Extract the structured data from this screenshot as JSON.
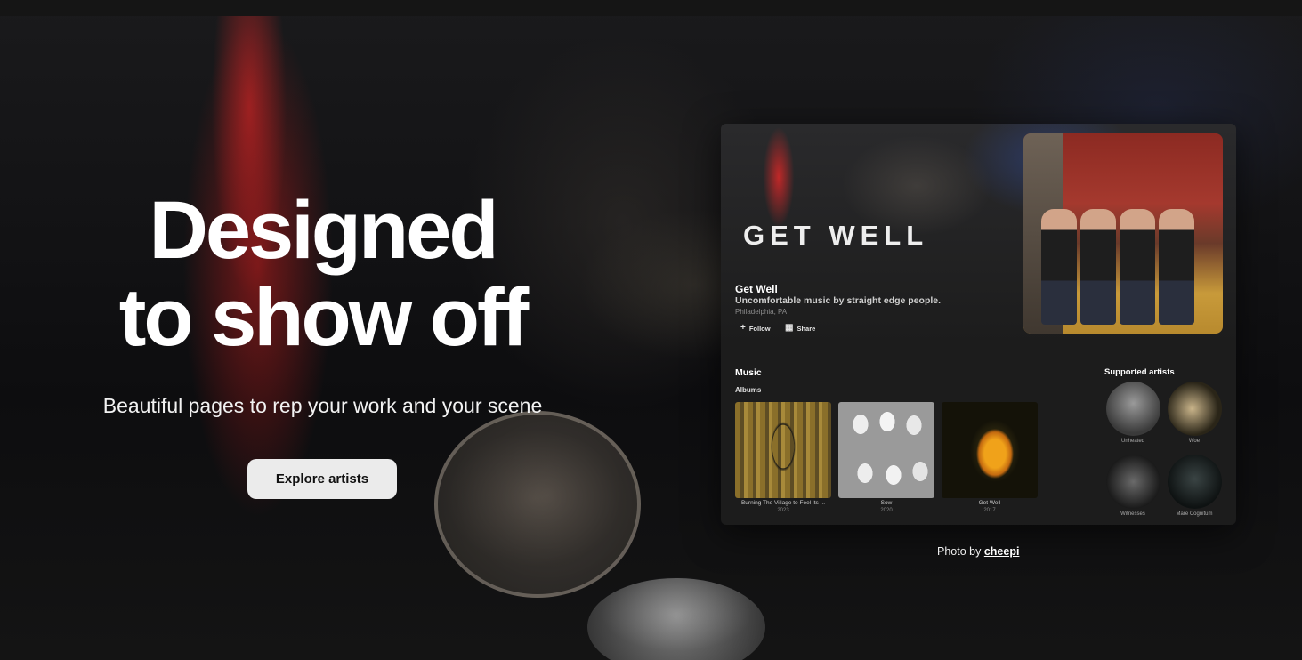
{
  "hero": {
    "title_line1": "Designed",
    "title_line2": "to show off",
    "subtitle": "Beautiful pages to rep your work and your scene",
    "cta_label": "Explore artists"
  },
  "preview": {
    "banner_logo": "GET WELL",
    "artist_name": "Get Well",
    "artist_tagline": "Uncomfortable music by straight edge people.",
    "artist_location": "Philadelphia, PA",
    "follow_label": "Follow",
    "share_label": "Share",
    "follow_icon": "plus-icon",
    "share_icon": "share-icon",
    "music_heading": "Music",
    "albums_heading": "Albums",
    "albums": [
      {
        "title": "Burning The Village to Feel Its ...",
        "year": "2023"
      },
      {
        "title": "Sow",
        "year": "2020"
      },
      {
        "title": "Get Well",
        "year": "2017"
      }
    ],
    "supported_heading": "Supported artists",
    "supported_artists": [
      {
        "name": "Unheated"
      },
      {
        "name": "Woe"
      },
      {
        "name": "Witnesses"
      },
      {
        "name": "Mare Cognitum"
      }
    ]
  },
  "credit": {
    "prefix": "Photo by",
    "photographer": "cheepi"
  },
  "colors": {
    "background": "#121212",
    "button_bg": "#ebebeb",
    "card_bg": "#1c1c1c",
    "accent_red": "#e02828"
  }
}
